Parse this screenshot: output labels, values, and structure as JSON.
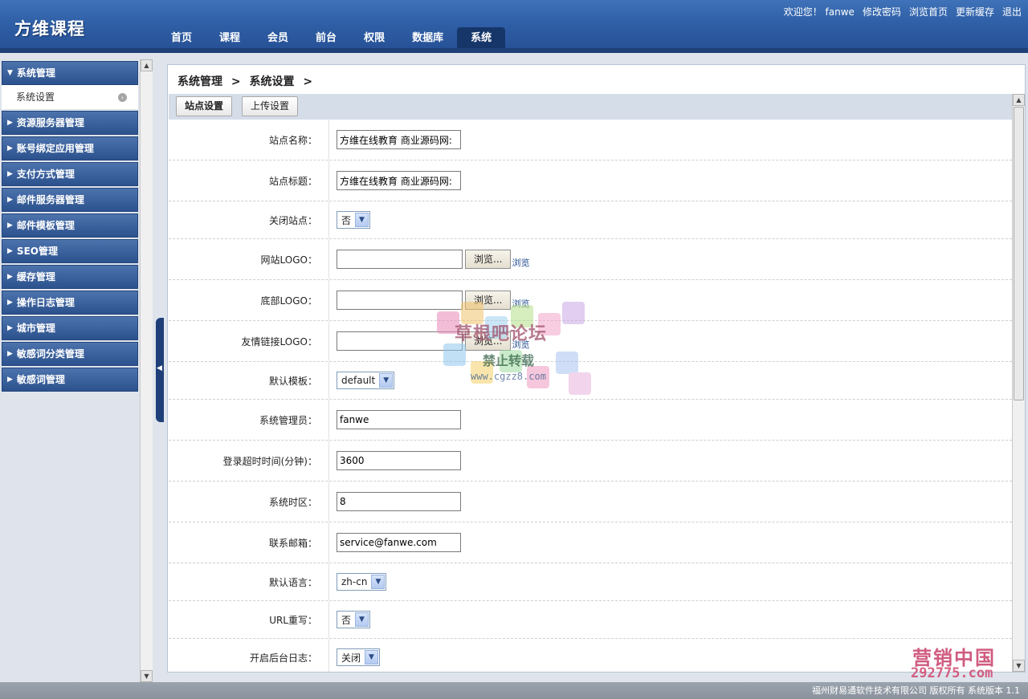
{
  "app": {
    "logo": "方维课程"
  },
  "top_links": {
    "welcome": "欢迎您！ fanwe",
    "change_password": "修改密码",
    "browse_home": "浏览首页",
    "update_cache": "更新缓存",
    "logout": "退出"
  },
  "nav": [
    {
      "label": "首页"
    },
    {
      "label": "课程"
    },
    {
      "label": "会员"
    },
    {
      "label": "前台"
    },
    {
      "label": "权限"
    },
    {
      "label": "数据库"
    },
    {
      "label": "系统",
      "active": true
    }
  ],
  "sidebar": {
    "group_title": "系统管理",
    "group_sub": "系统设置",
    "items": [
      {
        "label": "资源服务器管理"
      },
      {
        "label": "账号绑定应用管理"
      },
      {
        "label": "支付方式管理"
      },
      {
        "label": "邮件服务器管理"
      },
      {
        "label": "邮件模板管理"
      },
      {
        "label": "SEO管理"
      },
      {
        "label": "缓存管理"
      },
      {
        "label": "操作日志管理"
      },
      {
        "label": "城市管理"
      },
      {
        "label": "敏感词分类管理"
      },
      {
        "label": "敏感词管理"
      }
    ]
  },
  "breadcrumb": {
    "level1": "系统管理",
    "sep": ">",
    "level2": "系统设置"
  },
  "tabs": {
    "site_settings": "站点设置",
    "upload_settings": "上传设置"
  },
  "form": {
    "site_name": {
      "label": "站点名称：",
      "value": "方维在线教育 商业源码网:"
    },
    "site_title": {
      "label": "站点标题：",
      "value": "方维在线教育 商业源码网:"
    },
    "close_site": {
      "label": "关闭站点：",
      "value": "否"
    },
    "site_logo": {
      "label": "网站LOGO：",
      "value": "",
      "browse": "浏览...",
      "view": "浏览"
    },
    "footer_logo": {
      "label": "底部LOGO：",
      "value": "",
      "browse": "浏览...",
      "view": "浏览"
    },
    "link_logo": {
      "label": "友情链接LOGO：",
      "value": "",
      "browse": "浏览...",
      "view": "浏览"
    },
    "default_template": {
      "label": "默认模板：",
      "value": "default"
    },
    "admin": {
      "label": "系统管理员：",
      "value": "fanwe"
    },
    "login_timeout": {
      "label": "登录超时时间(分钟)：",
      "value": "3600"
    },
    "timezone": {
      "label": "系统时区：",
      "value": "8"
    },
    "email": {
      "label": "联系邮箱：",
      "value": "service@fanwe.com"
    },
    "language": {
      "label": "默认语言：",
      "value": "zh-cn"
    },
    "url_rewrite": {
      "label": "URL重写：",
      "value": "否"
    },
    "admin_log": {
      "label": "开启后台日志：",
      "value": "关闭"
    }
  },
  "footer": {
    "text": "福州财易通软件技术有限公司 版权所有 系统版本 1.1"
  },
  "watermark": {
    "forum": "草根吧论坛",
    "no_repost": "禁止转载",
    "url": "www.cgzz8.com",
    "brand": "营销中国",
    "brand_url": "292775.com"
  }
}
